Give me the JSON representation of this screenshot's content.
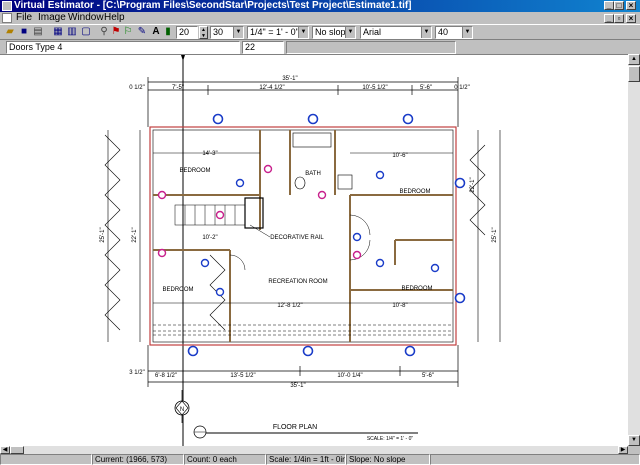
{
  "window": {
    "title": "Virtual Estimator - [C:\\Program Files\\SecondStar\\Projects\\Test Project\\Estimate1.tif]"
  },
  "menu": [
    "File",
    "Image",
    "Window",
    "Help"
  ],
  "toolbar": {
    "line_width": "20",
    "line_spacing": "30",
    "scale": "1/4\" = 1' - 0\"",
    "slope": "No slope",
    "font": "Arial",
    "font_size": "40"
  },
  "properties": {
    "item_name": "Doors Type 4",
    "item_count": "22"
  },
  "plan": {
    "overall_top": "35'-1\"",
    "overall_bottom": "35'-1\"",
    "top_dims": [
      "7'-5\"",
      "12'-4 1/2\"",
      "10'-5 1/2\"",
      "5'-6\""
    ],
    "bottom_dims": [
      "6'-8 1/2\"",
      "13'-5 1/2\"",
      "10'-0 1/4\"",
      "5'-6\""
    ],
    "side_left_outer": "25'-1\"",
    "side_left_inner": "22'-1\"",
    "side_right_outer": "25'-1\"",
    "side_right_inner": "22'-1\"",
    "small_dims": [
      "0 1/2\"",
      "3 1/2\"",
      "0 1/2\""
    ],
    "rooms": [
      "BEDROOM",
      "BATH",
      "BEDROOM",
      "RECREATION ROOM",
      "BEDROOM",
      "BEDROOM"
    ],
    "labels": [
      "DECORATIVE RAIL",
      "14'-3\"",
      "10'-2\"",
      "10'-6\"",
      "12'-8 1/2\"",
      "10'-8\""
    ],
    "title": "FLOOR PLAN",
    "scale_note": "SCALE: 1/4\" = 1' - 0\"",
    "north": "N"
  },
  "status": {
    "blank": "",
    "current": "Current: (1966, 573)",
    "count": "Count: 0 each",
    "scale": "Scale: 1/4in = 1ft - 0in",
    "slope": "Slope: No slope"
  },
  "colors": {
    "door_marker": "#1a3cc8",
    "door_marker_alt": "#c8208c",
    "wall_line": "#c04040"
  }
}
